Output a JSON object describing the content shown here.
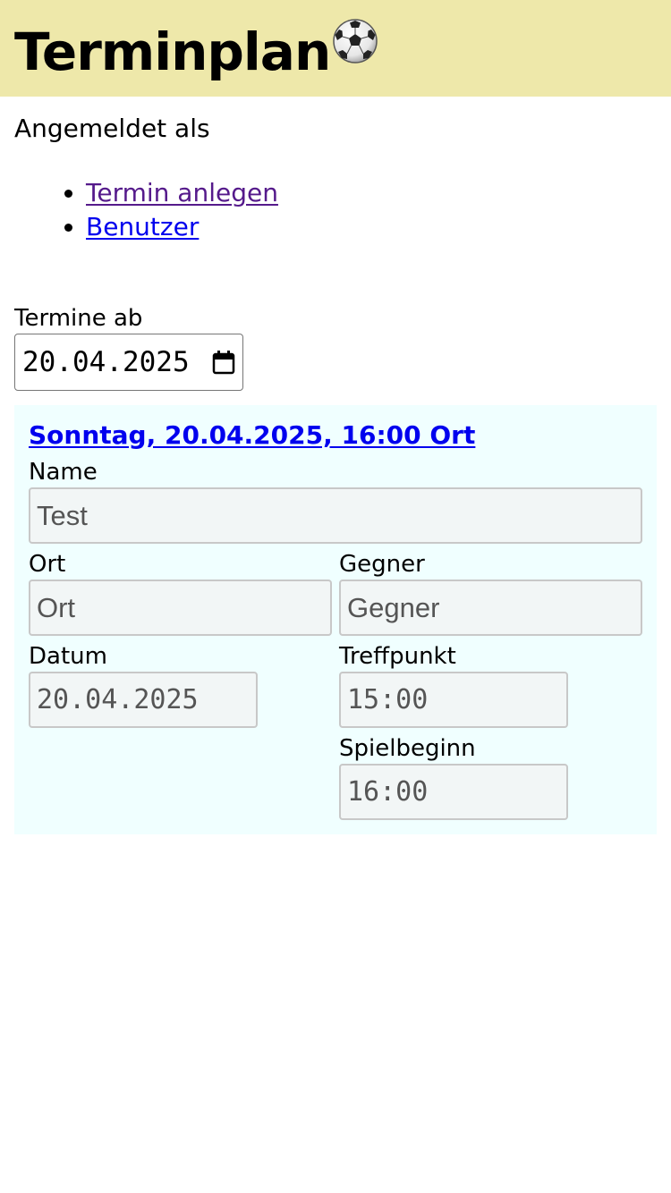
{
  "header": {
    "title": "Terminplan",
    "icon": "soccer-ball-icon",
    "background_color": "#eee8aa"
  },
  "user": {
    "logged_in_text": "Angemeldet als"
  },
  "nav": {
    "items": [
      {
        "label": "Termin anlegen",
        "visited": true
      },
      {
        "label": "Benutzer",
        "visited": false
      }
    ],
    "link_color": "#0000ee",
    "visited_color": "#551a8b"
  },
  "filter": {
    "label": "Termine ab",
    "date_value": "20.04.2025",
    "icon": "calendar-icon"
  },
  "events": [
    {
      "heading": "Sonntag, 20.04.2025, 16:00 Ort",
      "background_color": "#f0ffff",
      "fields": {
        "name": {
          "label": "Name",
          "value": "Test"
        },
        "ort": {
          "label": "Ort",
          "value": "Ort"
        },
        "gegner": {
          "label": "Gegner",
          "value": "Gegner"
        },
        "datum": {
          "label": "Datum",
          "value": "20.04.2025"
        },
        "treffpunkt": {
          "label": "Treffpunkt",
          "value": "15:00"
        },
        "spielbeginn": {
          "label": "Spielbeginn",
          "value": "16:00"
        }
      }
    }
  ]
}
